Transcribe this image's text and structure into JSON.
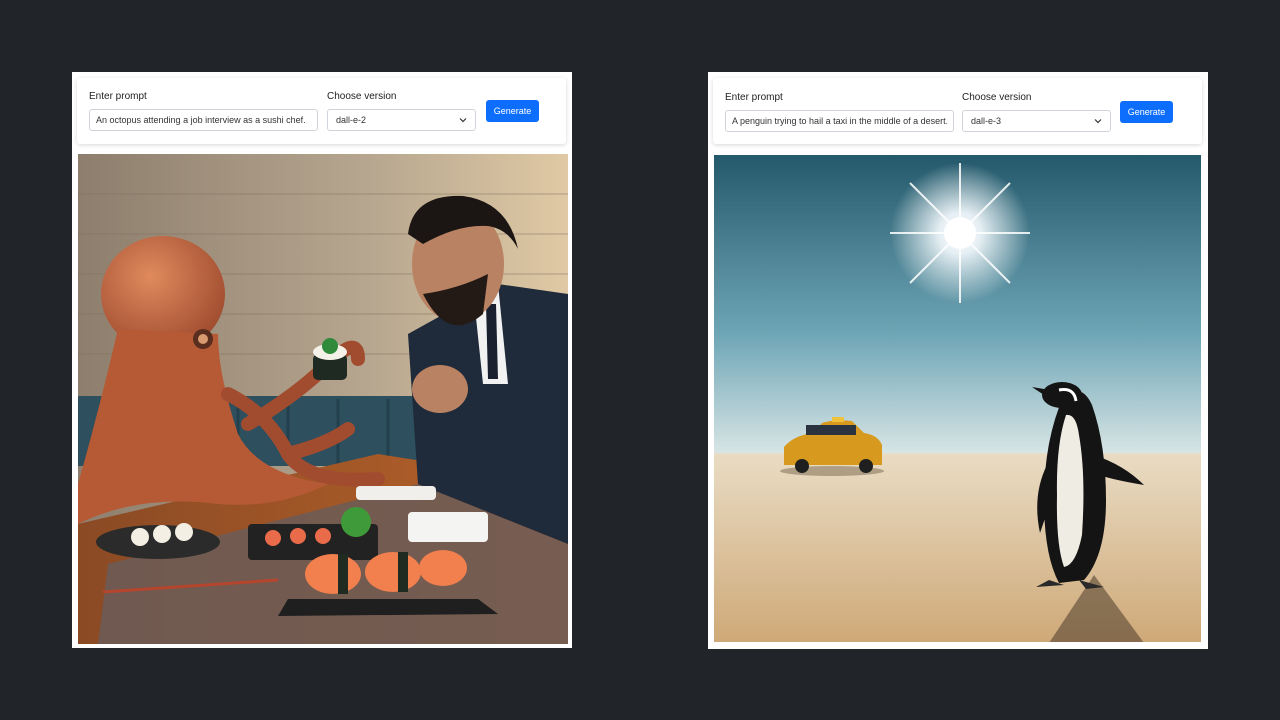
{
  "colors": {
    "page_background": "#212428",
    "primary_button": "#0d6efd"
  },
  "panels": [
    {
      "prompt_label": "Enter prompt",
      "prompt_value": "An octopus attending a job interview as a sushi chef.",
      "version_label": "Choose version",
      "version_selected": "dall-e-2",
      "generate_label": "Generate",
      "image": {
        "icon": "generated-image",
        "depicts": "octopus-interview-sushi"
      }
    },
    {
      "prompt_label": "Enter prompt",
      "prompt_value": "A penguin trying to hail a taxi in the middle of a desert.",
      "version_label": "Choose version",
      "version_selected": "dall-e-3",
      "generate_label": "Generate",
      "image": {
        "icon": "generated-image",
        "depicts": "penguin-desert-taxi"
      }
    }
  ]
}
